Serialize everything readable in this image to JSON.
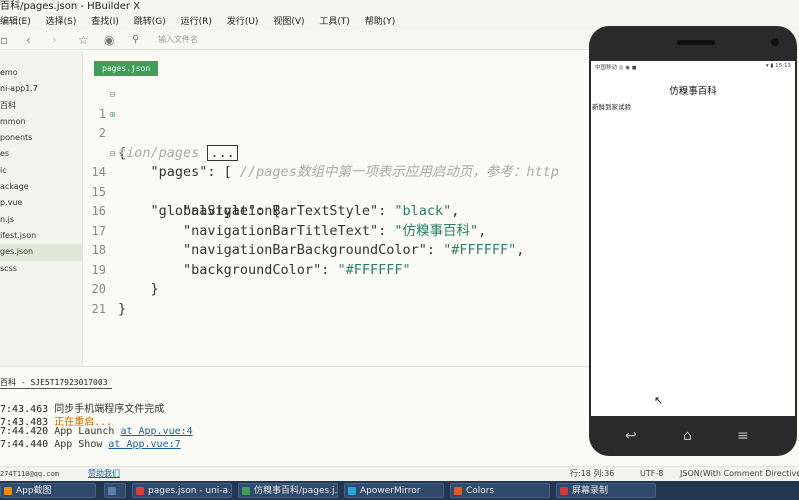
{
  "window": {
    "title": "百科/pages.json - HBuilder X"
  },
  "menu": [
    "编辑(E)",
    "选择(S)",
    "查找(I)",
    "跳转(G)",
    "运行(R)",
    "发行(U)",
    "视图(V)",
    "工具(T)",
    "帮助(Y)"
  ],
  "toolbar": {
    "search_placeholder": "输入文件名"
  },
  "sidebar": {
    "items": [
      {
        "label": "emo",
        "active": false
      },
      {
        "label": "ni-app1.7",
        "active": false
      },
      {
        "label": "百科",
        "active": false
      },
      {
        "label": "mmon",
        "active": false
      },
      {
        "label": "ponents",
        "active": false
      },
      {
        "label": "es",
        "active": false
      },
      {
        "label": "ic",
        "active": false
      },
      {
        "label": "ackage",
        "active": false
      },
      {
        "label": "p.vue",
        "active": false
      },
      {
        "label": "n.js",
        "active": false
      },
      {
        "label": "ifest.json",
        "active": false
      },
      {
        "label": "ges.json",
        "active": true
      },
      {
        "label": "scss",
        "active": false
      }
    ]
  },
  "editor": {
    "tab_label": "pages.json",
    "lines": [
      {
        "num": "1",
        "fold": "⊟",
        "text": "{"
      },
      {
        "num": "2",
        "fold": "⊞",
        "pre": "    \"pages\": [ ",
        "comment": "//pages数组中第一项表示应用启动页，参考：http"
      },
      {
        "num": "",
        "fold": "",
        "pre": "tion/pages ",
        "box": "..."
      },
      {
        "num": "14",
        "fold": "⊟",
        "pre": "    \"globalStyle\": {"
      },
      {
        "num": "15",
        "fold": "",
        "key": "        \"navigationBarTextStyle\": ",
        "val": "\"black\"",
        "post": ","
      },
      {
        "num": "16",
        "fold": "",
        "key": "        \"navigationBarTitleText\": ",
        "val": "\"仿糗事百科\"",
        "post": ","
      },
      {
        "num": "17",
        "fold": "",
        "key": "        \"navigationBarBackgroundColor\": ",
        "val": "\"#FFFFFF\"",
        "post": ","
      },
      {
        "num": "18",
        "fold": "",
        "key": "        \"backgroundColor\": ",
        "val": "\"#FFFFFF\"",
        "post": ""
      },
      {
        "num": "19",
        "fold": "",
        "pre": "    }"
      },
      {
        "num": "20",
        "fold": "",
        "pre": "}"
      },
      {
        "num": "21",
        "fold": "",
        "pre": ""
      }
    ]
  },
  "console": {
    "title": "百科 - SJE5T17923017003",
    "lines": [
      {
        "time": "7:43.463",
        "msg": "同步手机端程序文件完成",
        "style": "m",
        "link": ""
      },
      {
        "time": "7:43.483",
        "msg": "正在重启...",
        "style": "m2",
        "link": ""
      },
      {
        "time": "7:44.420",
        "msg": " App Launch ",
        "style": "m",
        "link": "at App.vue:4"
      },
      {
        "time": "7:44.440",
        "msg": " App Show ",
        "style": "m",
        "link": "at App.vue:7"
      }
    ]
  },
  "statusbar": {
    "account": "274T110@qq.com",
    "help_link": "赞助我们",
    "position": "行:18 列:36",
    "encoding": "UTF-8",
    "mode": "JSON(With Comment Directive)"
  },
  "taskbar": {
    "items": [
      {
        "label": "App截图",
        "color": "#f08c00"
      },
      {
        "label": "",
        "color": "#5a7fb0"
      },
      {
        "label": "pages.json - uni-a...",
        "color": "#e23d3d"
      },
      {
        "label": "仿糗事百科/pages.j...",
        "color": "#3f9e57"
      },
      {
        "label": "ApowerMirror",
        "color": "#2aa3e0"
      },
      {
        "label": "Colors",
        "color": "#e05a2a"
      },
      {
        "label": "屏幕录制",
        "color": "#d03a3a"
      }
    ]
  },
  "phone": {
    "status_left": "中国移动 ◎ ◉ ◼",
    "status_right": "▾ ▮ 15:13",
    "nav_title": "仿糗事百科",
    "page_text": "新鲜到家试验"
  }
}
